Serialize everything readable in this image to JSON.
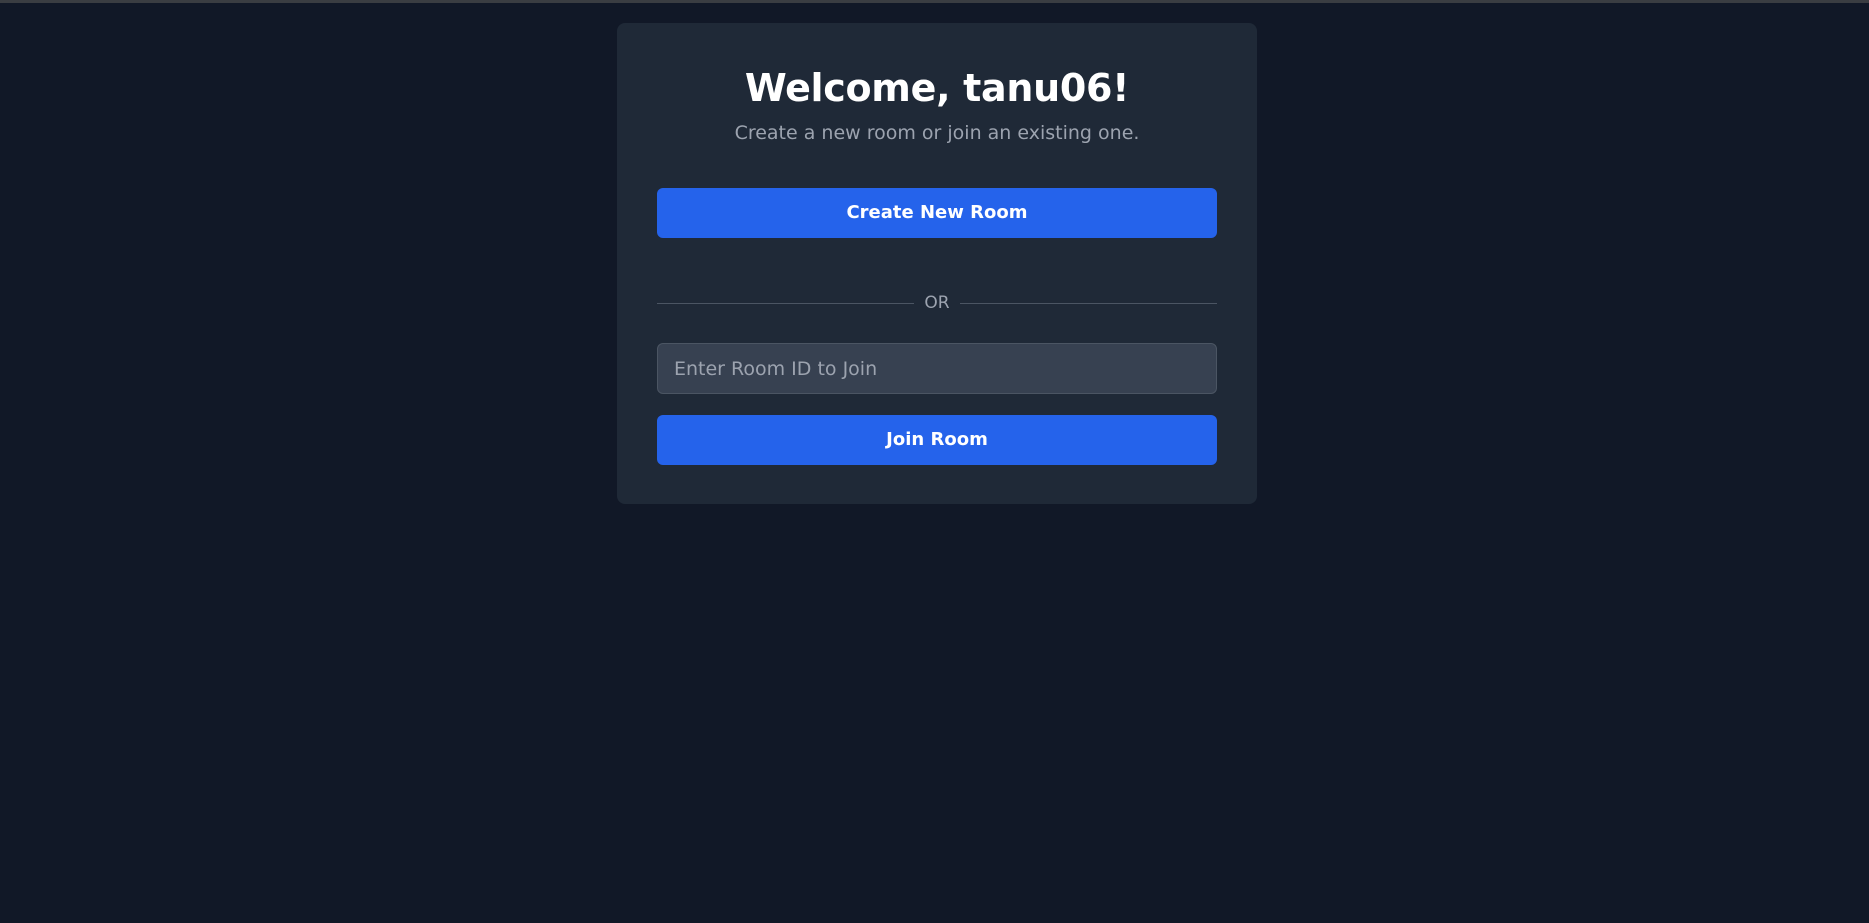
{
  "lobby": {
    "title": "Welcome, tanu06!",
    "subtitle": "Create a new room or join an existing one.",
    "create_button_label": "Create New Room",
    "divider_label": "OR",
    "room_input": {
      "value": "",
      "placeholder": "Enter Room ID to Join"
    },
    "join_button_label": "Join Room"
  },
  "colors": {
    "background": "#111827",
    "card": "#1f2937",
    "accent": "#2563eb",
    "input_background": "#374151",
    "muted_text": "#9ca3af"
  }
}
